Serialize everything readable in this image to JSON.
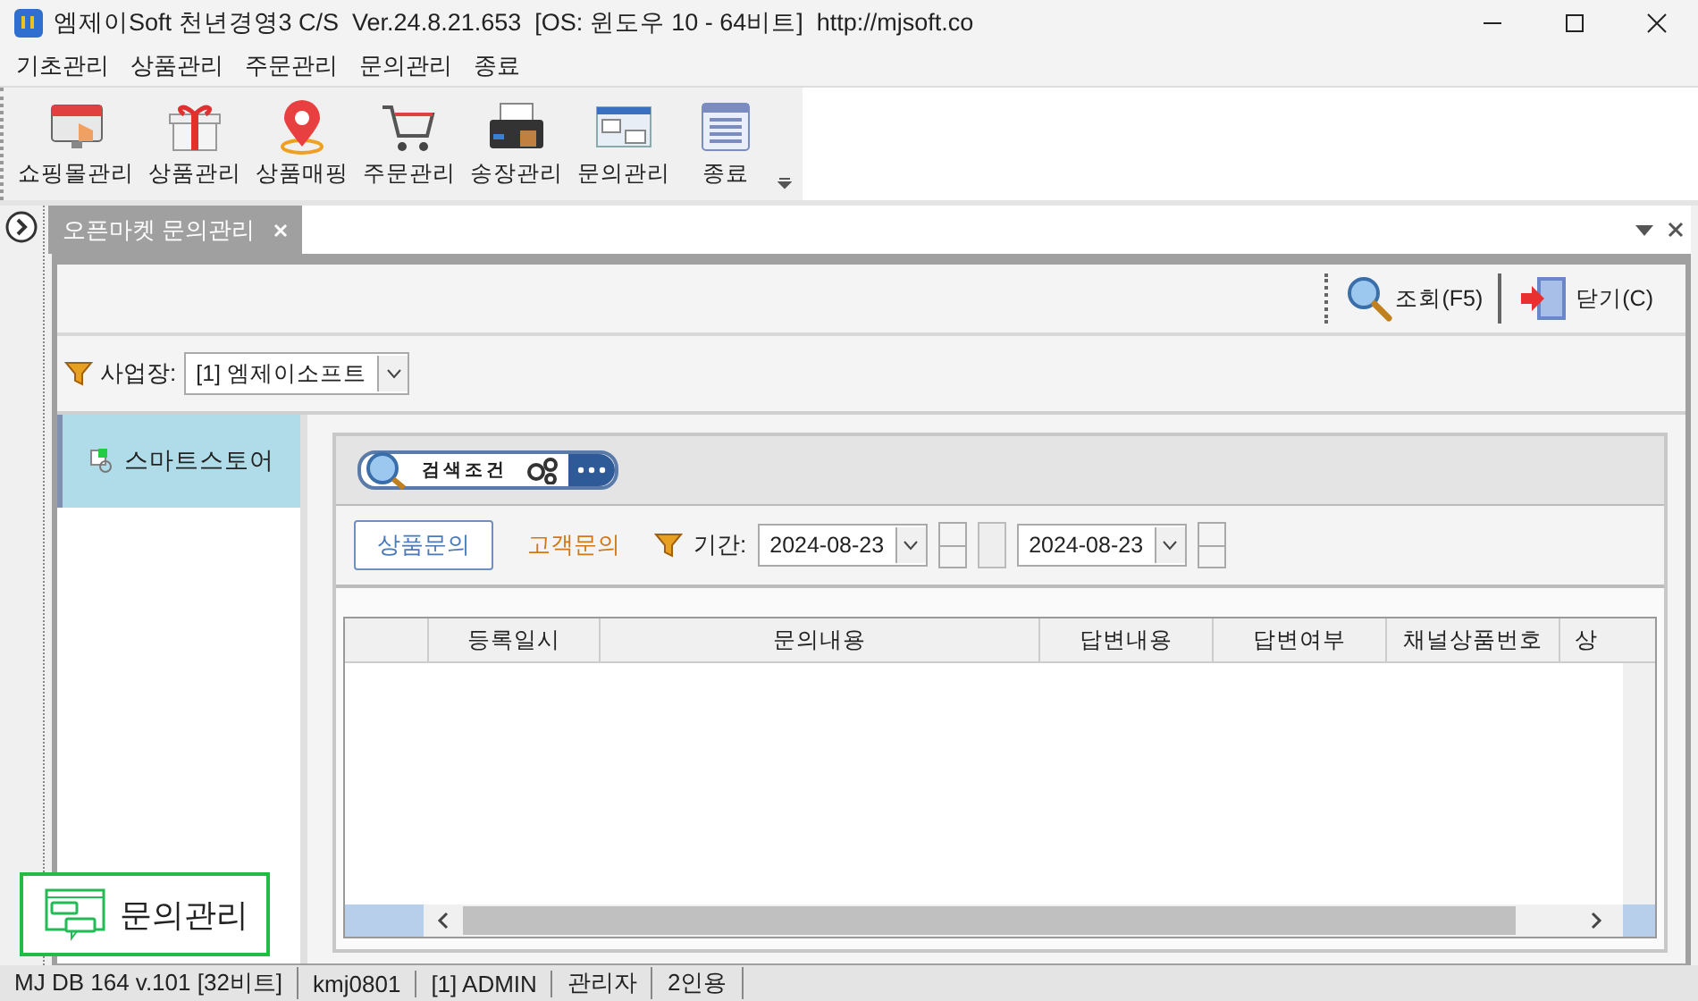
{
  "window": {
    "title": "엠제이Soft 천년경영3 C/S  Ver.24.8.21.653  [OS: 윈도우 10 - 64비트]  http://mjsoft.co"
  },
  "menu": [
    "기초관리",
    "상품관리",
    "주문관리",
    "문의관리",
    "종료"
  ],
  "toolbar": [
    {
      "label": "쇼핑몰관리",
      "kind": "shop"
    },
    {
      "label": "상품관리",
      "kind": "gift"
    },
    {
      "label": "상품매핑",
      "kind": "pin"
    },
    {
      "label": "주문관리",
      "kind": "cart"
    },
    {
      "label": "송장관리",
      "kind": "printer"
    },
    {
      "label": "문의관리",
      "kind": "qa"
    },
    {
      "label": "종료",
      "kind": "list"
    }
  ],
  "document_tabs": [
    {
      "label": "오픈마켓 문의관리",
      "selected": true
    }
  ],
  "doc_toolbar": [
    {
      "label": "조회(F5)",
      "kind": "search"
    },
    {
      "label": "닫기(C)",
      "kind": "close"
    }
  ],
  "business": {
    "label": "사업장:",
    "value": "[1] 엠제이소프트"
  },
  "side_list": [
    {
      "label": "스마트스토어",
      "selected": true
    }
  ],
  "search_header": {
    "label": "검색조건"
  },
  "inquiry_types": [
    {
      "label": "상품문의",
      "selected": true
    },
    {
      "label": "고객문의",
      "selected": false
    }
  ],
  "period": {
    "label": "기간:",
    "from": "2024-08-23",
    "to": "2024-08-23"
  },
  "grid": {
    "columns": [
      "등록일시",
      "문의내용",
      "답변내용",
      "답변여부",
      "채널상품번호",
      "상"
    ]
  },
  "status_bar": [
    "MJ DB 164 v.101 [32비트]",
    "kmj0801",
    "[1] ADMIN",
    "관리자",
    "2인용"
  ],
  "overlay": {
    "label": "문의관리"
  }
}
